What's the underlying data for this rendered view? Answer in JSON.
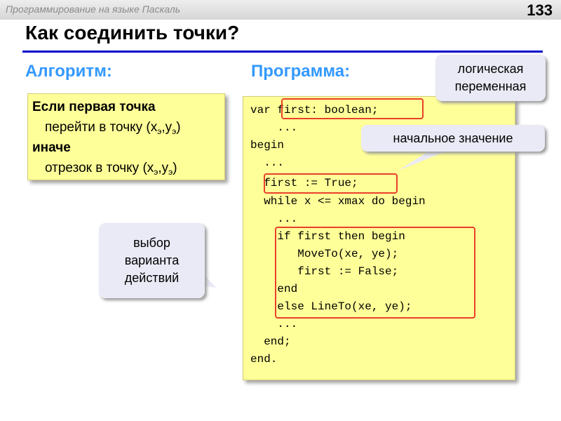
{
  "header": {
    "course": "Программирование на языке Паскаль",
    "page_number": "133"
  },
  "title": "Как соединить точки?",
  "algorithm": {
    "heading": "Алгоритм:",
    "if_line": "Если первая точка",
    "then_text": "перейти в точку (x",
    "else_keyword": "иначе",
    "else_text": "отрезок в точку (x",
    "sub": "э",
    "sep": ",y",
    "close": ")"
  },
  "program": {
    "heading": "Программа:",
    "lines": [
      "var first: boolean;",
      "    ...",
      "begin",
      "  ...",
      "  first := True;",
      "  while x <= xmax do begin",
      "    ...",
      "    if first then begin",
      "       MoveTo(xe, ye);",
      "       first := False;",
      "    end",
      "    else LineTo(xe, ye);",
      "    ...",
      "  end;",
      "end."
    ]
  },
  "callouts": {
    "logical_line1": "логическая",
    "logical_line2": "переменная",
    "initial": "начальное значение",
    "choice_line1": "выбор",
    "choice_line2": "варианта",
    "choice_line3": "действий"
  },
  "colors": {
    "section_heading": "#3399ff",
    "title_rule": "#0000cc",
    "box_fill": "#ffff99",
    "highlight": "#e8402a",
    "callout_fill": "#eaeaf6"
  }
}
